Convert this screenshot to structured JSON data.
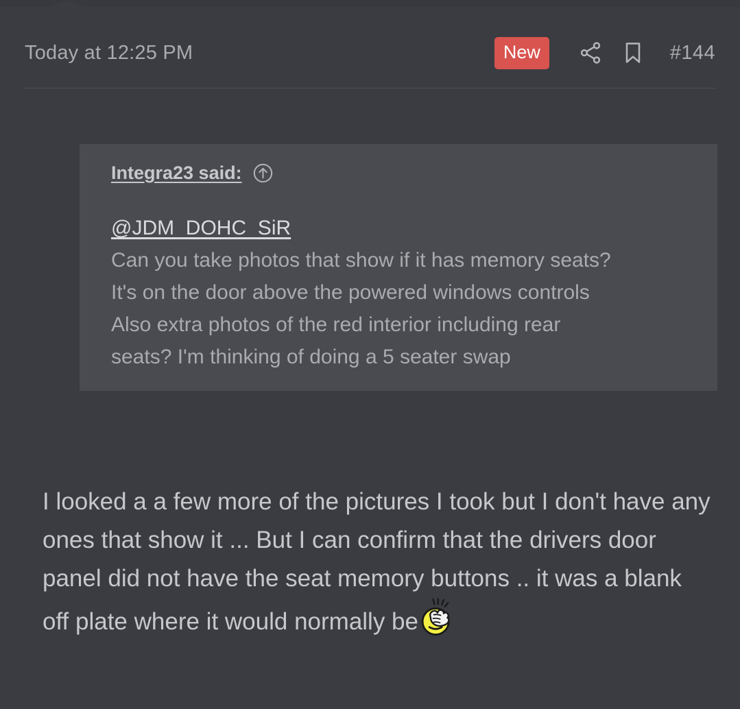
{
  "post": {
    "date": "Today at 12:25 PM",
    "new_badge": "New",
    "post_number": "#144",
    "icons": {
      "share": "share-icon",
      "bookmark": "bookmark-icon",
      "quote_jump": "circle-arrow-up-icon"
    }
  },
  "quote": {
    "author_line": "Integra23 said:",
    "mention": "@JDM_DOHC_SiR",
    "lines": [
      "Can you take photos that show if it has memory seats?",
      "It's on the door above the powered windows controls",
      "Also extra photos of the red interior including rear",
      "seats? I'm thinking of doing a 5 seater swap"
    ]
  },
  "body": {
    "text": "I looked a a few more of the pictures I took but I don't have any ones that show it ... But I can confirm that the drivers door panel did not have the seat memory buttons .. it was a blank off plate where it would normally be",
    "emoji": "facepalm-emoji"
  },
  "colors": {
    "page_background": "#3a3c41",
    "quote_background": "#494b50",
    "badge_red": "#d9534f",
    "primary_text": "#c6c8cb",
    "muted_text": "#a9abaf",
    "divider": "#4d4f55"
  }
}
